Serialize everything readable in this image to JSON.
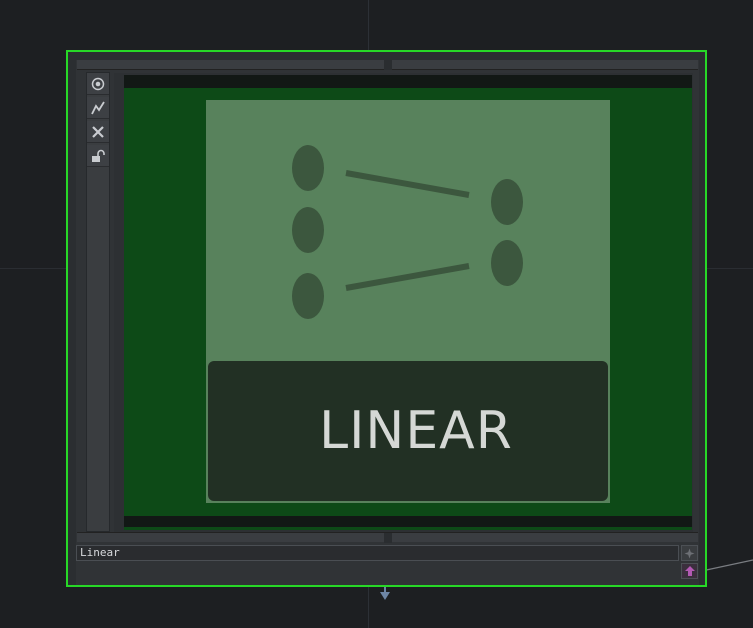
{
  "node": {
    "thumbnail_label": "LINEAR",
    "name_field_value": "Linear"
  },
  "icons": {
    "sidebar": [
      "target-icon",
      "graph-line-icon",
      "close-icon",
      "unlock-icon"
    ],
    "corner": [
      "add-input-icon",
      "output-connector-icon"
    ]
  },
  "colors": {
    "selection_border": "#27d827",
    "viewer_background": "#0d4a17",
    "thumbnail_background": "#58825c",
    "thumbnail_label_background": "#223024"
  }
}
